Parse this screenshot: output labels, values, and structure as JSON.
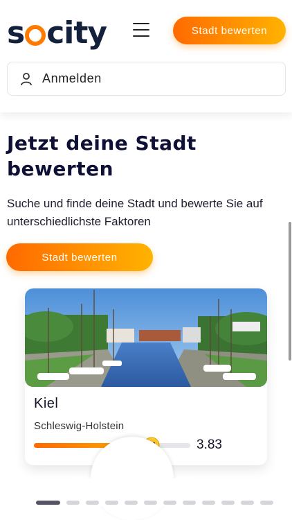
{
  "header": {
    "logo_text": "socity",
    "menu_icon": "hamburger-menu-icon",
    "cta_label": "Stadt bewerten",
    "login_label": "Anmelden",
    "login_icon": "user-icon"
  },
  "hero": {
    "title": "Jetzt deine Stadt bewerten",
    "subtitle": "Suche und finde deine Stadt und bewerte Sie auf unterschiedlichste Faktoren",
    "cta_label": "Stadt bewerten"
  },
  "city_card": {
    "name": "Kiel",
    "region": "Schleswig-Holstein",
    "rating": "3.83",
    "rating_fraction": 0.766,
    "rating_icon": "smiley-icon"
  },
  "carousel": {
    "dot_count": 12,
    "active_index": 0
  },
  "colors": {
    "accent_start": "#ff6a00",
    "accent_end": "#ffb300",
    "brand_dark": "#14213d"
  }
}
